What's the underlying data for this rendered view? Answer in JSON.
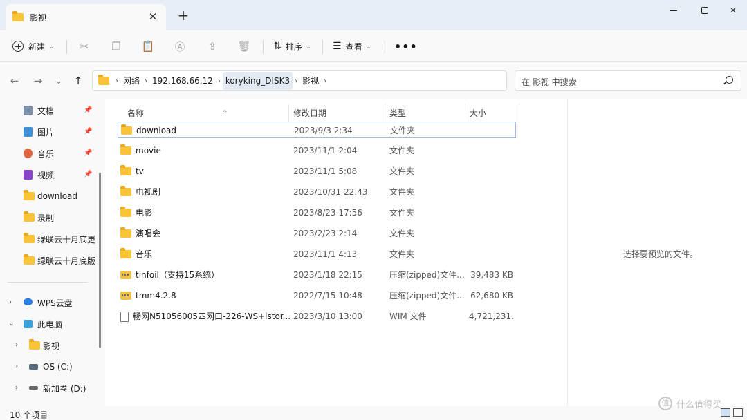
{
  "window": {
    "tab_title": "影视",
    "tab_close": "✕",
    "new_tab": "+",
    "minimize_icon": "minimize",
    "maximize_icon": "maximize",
    "close_icon": "✕"
  },
  "toolbar": {
    "new_label": "新建",
    "sort_label": "排序",
    "view_label": "查看",
    "more": "•••",
    "icons": [
      "cut-icon",
      "copy-icon",
      "paste-icon",
      "rename-icon",
      "share-icon",
      "delete-icon"
    ]
  },
  "nav": {
    "back": "←",
    "forward": "→",
    "recent": "⌄",
    "up": "↑",
    "breadcrumb": [
      "网络",
      "192.168.66.12",
      "koryking_DISK3",
      "影视"
    ],
    "refresh": "↻",
    "search_placeholder": "在 影视 中搜索"
  },
  "sidebar": {
    "quick_access": [
      {
        "label": "文档",
        "icon": "documents-icon",
        "pinned": true
      },
      {
        "label": "图片",
        "icon": "pictures-icon",
        "pinned": true
      },
      {
        "label": "音乐",
        "icon": "music-icon",
        "pinned": true
      },
      {
        "label": "视频",
        "icon": "videos-icon",
        "pinned": true
      },
      {
        "label": "download",
        "icon": "folder-icon",
        "pinned": false
      },
      {
        "label": "录制",
        "icon": "folder-icon",
        "pinned": false
      },
      {
        "label": "绿联云十月底更",
        "icon": "folder-icon",
        "pinned": false
      },
      {
        "label": "绿联云十月底版",
        "icon": "folder-icon",
        "pinned": false
      }
    ],
    "tree": [
      {
        "label": "WPS云盘",
        "icon": "cloud-icon",
        "expanded": false
      },
      {
        "label": "此电脑",
        "icon": "computer-icon",
        "expanded": true
      },
      {
        "label": "影视",
        "icon": "folder-icon",
        "expanded": false
      },
      {
        "label": "OS (C:)",
        "icon": "drive-icon",
        "expanded": false
      },
      {
        "label": "新加卷 (D:)",
        "icon": "drive-icon",
        "expanded": false
      }
    ],
    "pin_glyph": "📌"
  },
  "filelist": {
    "columns": [
      "名称",
      "修改日期",
      "类型",
      "大小"
    ],
    "sort_arrow": "^",
    "rows": [
      {
        "name": "download",
        "date": "2023/9/3 2:34",
        "type": "文件夹",
        "size": "",
        "icon": "folder",
        "selected": true
      },
      {
        "name": "movie",
        "date": "2023/11/1 2:04",
        "type": "文件夹",
        "size": "",
        "icon": "folder",
        "selected": false
      },
      {
        "name": "tv",
        "date": "2023/11/1 5:08",
        "type": "文件夹",
        "size": "",
        "icon": "folder",
        "selected": false
      },
      {
        "name": "电视剧",
        "date": "2023/10/31 22:43",
        "type": "文件夹",
        "size": "",
        "icon": "folder",
        "selected": false
      },
      {
        "name": "电影",
        "date": "2023/8/23 17:56",
        "type": "文件夹",
        "size": "",
        "icon": "folder",
        "selected": false
      },
      {
        "name": "演唱会",
        "date": "2023/2/23 2:14",
        "type": "文件夹",
        "size": "",
        "icon": "folder",
        "selected": false
      },
      {
        "name": "音乐",
        "date": "2023/11/1 4:13",
        "type": "文件夹",
        "size": "",
        "icon": "folder",
        "selected": false
      },
      {
        "name": "tinfoil（支持15系统）",
        "date": "2023/1/18 22:15",
        "type": "压缩(zipped)文件...",
        "size": "39,483 KB",
        "icon": "zip",
        "selected": false
      },
      {
        "name": "tmm4.2.8",
        "date": "2022/7/15 10:48",
        "type": "压缩(zipped)文件...",
        "size": "62,680 KB",
        "icon": "zip",
        "selected": false
      },
      {
        "name": "畅网N51056005四网口-226-WS+istor...",
        "date": "2023/3/10 13:00",
        "type": "WIM 文件",
        "size": "4,721,231...",
        "icon": "file",
        "selected": false
      }
    ]
  },
  "preview": {
    "message": "选择要预览的文件。"
  },
  "status": {
    "count": "10 个项目"
  },
  "watermark": {
    "text": "什么值得买",
    "glyph": "值"
  },
  "colors": {
    "folder": "#f9c437",
    "selection_border": "#99bce8",
    "titlebar": "#e8eef6"
  }
}
